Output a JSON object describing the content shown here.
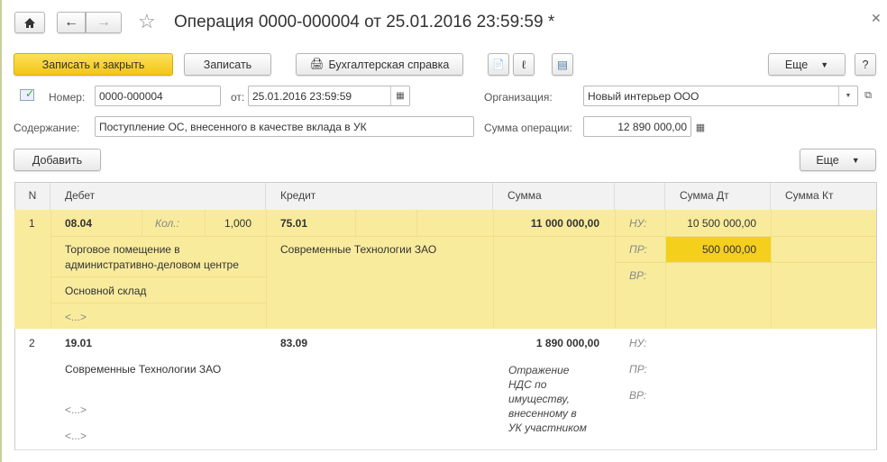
{
  "title": "Операция 0000-000004 от 25.01.2016 23:59:59 *",
  "toolbar": {
    "save_close": "Записать и закрыть",
    "save": "Записать",
    "report": "Бухгалтерская справка",
    "more": "Еще",
    "help": "?"
  },
  "form": {
    "number_label": "Номер:",
    "number": "0000-000004",
    "date_label": "от:",
    "date": "25.01.2016 23:59:59",
    "org_label": "Организация:",
    "org": "Новый интерьер ООО",
    "content_label": "Содержание:",
    "content": "Поступление ОС, внесенного в качестве вклада в УК",
    "sum_label": "Сумма операции:",
    "sum": "12 890 000,00"
  },
  "table_toolbar": {
    "add": "Добавить",
    "more": "Еще"
  },
  "table": {
    "headers": {
      "n": "N",
      "debit": "Дебет",
      "credit": "Кредит",
      "sum": "Сумма",
      "sum_dt": "Сумма Дт",
      "sum_kt": "Сумма Кт"
    },
    "rows": [
      {
        "n": "1",
        "debit": "08.04",
        "qty_label": "Кол.:",
        "qty": "1,000",
        "credit": "75.01",
        "sum": "11 000 000,00",
        "nu": "НУ:",
        "pr": "ПР:",
        "vr": "ВР:",
        "nu_dt": "10 500 000,00",
        "pr_dt": "500 000,00",
        "debit_sub1": "Торговое помещение в",
        "debit_sub1b": "административно-деловом центре",
        "debit_sub2": "Основной склад",
        "debit_sub3": "<...>",
        "credit_sub1": "Современные Технологии ЗАО"
      },
      {
        "n": "2",
        "debit": "19.01",
        "credit": "83.09",
        "sum": "1 890 000,00",
        "nu": "НУ:",
        "pr": "ПР:",
        "vr": "ВР:",
        "debit_sub1": "Современные Технологии ЗАО",
        "debit_sub2": "<...>",
        "debit_sub3": "<...>",
        "comment": [
          "Отражение",
          "НДС по",
          "имуществу,",
          "внесенному в",
          "УК участником"
        ]
      }
    ]
  },
  "colors": {
    "accent": "#f5ca1e",
    "row_selected": "#f9eb9c",
    "cell_active": "#f4cf1c"
  }
}
